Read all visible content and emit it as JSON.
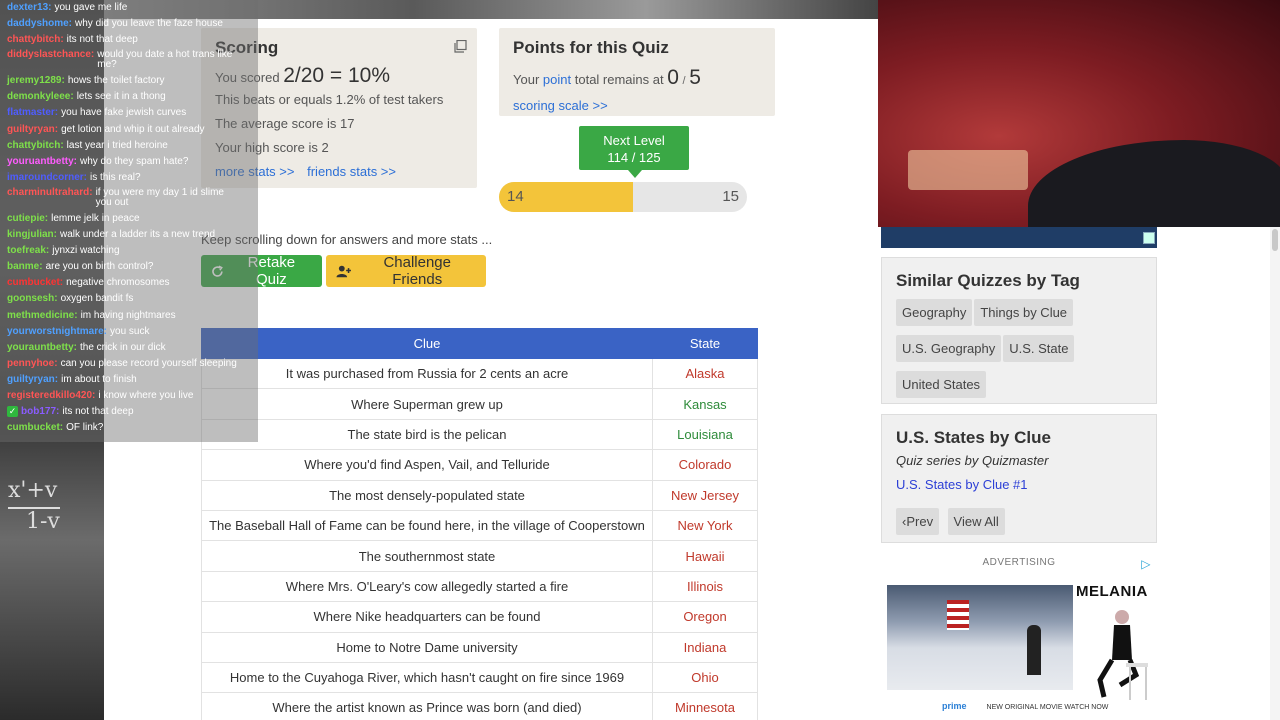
{
  "scoring": {
    "title": "Scoring",
    "scored_prefix": "You scored",
    "score_value": "2/20 = 10%",
    "beats": "This beats or equals 1.2% of test takers",
    "average": "The average score is 17",
    "high": "Your high score is 2",
    "more_stats": "more stats >>",
    "friends_stats": "friends stats >>"
  },
  "points": {
    "title": "Points for this Quiz",
    "prefix": "Your",
    "point_link": "point",
    "mid": "total remains at",
    "value": "0",
    "sep": "/",
    "max": "5",
    "scale_link": "scoring scale >>"
  },
  "level": {
    "label": "Next Level",
    "progress_text": "114 / 125",
    "current": "14",
    "next": "15",
    "progress_fraction": 0.54
  },
  "keep_scrolling": "Keep scrolling down for answers and more stats ...",
  "buttons": {
    "retake": "Retake Quiz",
    "challenge": "Challenge Friends"
  },
  "table": {
    "headers": [
      "Clue",
      "State"
    ],
    "rows": [
      {
        "clue": "It was purchased from Russia for 2 cents an acre",
        "state": "Alaska",
        "correct": false
      },
      {
        "clue": "Where Superman grew up",
        "state": "Kansas",
        "correct": true
      },
      {
        "clue": "The state bird is the pelican",
        "state": "Louisiana",
        "correct": true
      },
      {
        "clue": "Where you'd find Aspen, Vail, and Telluride",
        "state": "Colorado",
        "correct": false
      },
      {
        "clue": "The most densely-populated state",
        "state": "New Jersey",
        "correct": false
      },
      {
        "clue": "The Baseball Hall of Fame can be found here, in the village of Cooperstown",
        "state": "New York",
        "correct": false
      },
      {
        "clue": "The southernmost state",
        "state": "Hawaii",
        "correct": false
      },
      {
        "clue": "Where Mrs. O'Leary's cow allegedly started a fire",
        "state": "Illinois",
        "correct": false
      },
      {
        "clue": "Where Nike headquarters can be found",
        "state": "Oregon",
        "correct": false
      },
      {
        "clue": "Home to Notre Dame university",
        "state": "Indiana",
        "correct": false
      },
      {
        "clue": "Home to the Cuyahoga River, which hasn't caught on fire since 1969",
        "state": "Ohio",
        "correct": false
      },
      {
        "clue": "Where the artist known as Prince was born (and died)",
        "state": "Minnesota",
        "correct": false
      }
    ]
  },
  "similar": {
    "title": "Similar Quizzes by Tag",
    "tags": [
      "Geography",
      "Things by Clue",
      "U.S. Geography",
      "U.S. State",
      "United States"
    ]
  },
  "series": {
    "title": "U.S. States by Clue",
    "subtitle": "Quiz series by Quizmaster",
    "link": "U.S. States by Clue #1",
    "prev": "Prev",
    "view_all": "View All"
  },
  "ad": {
    "label": "ADVERTISING",
    "brand": "MELANIA",
    "prime": "prime",
    "prime_rest": "NEW ORIGINAL MOVIE WATCH NOW"
  },
  "chat": [
    {
      "user": "dexter13:",
      "text": "you gave me life",
      "color": "#4fa0ff"
    },
    {
      "user": "daddyshome:",
      "text": "why did you leave the faze house",
      "color": "#4fa0ff"
    },
    {
      "user": "chattybitch:",
      "text": "its not that deep",
      "color": "#ff5555"
    },
    {
      "user": "diddyslastchance:",
      "text": "would you date a hot trans like me?",
      "color": "#ff5555",
      "wrap": true
    },
    {
      "user": "jeremy1289:",
      "text": "hows the toilet factory",
      "color": "#7ee04a"
    },
    {
      "user": "demonkyleee:",
      "text": "lets see it in a thong",
      "color": "#7ee04a"
    },
    {
      "user": "flatmaster:",
      "text": "you have fake jewish curves",
      "color": "#4f5dff"
    },
    {
      "user": "guiltyryan:",
      "text": "get lotion and whip it out already",
      "color": "#ff5555"
    },
    {
      "user": "chattybitch:",
      "text": "last year i tried heroine",
      "color": "#7ee04a"
    },
    {
      "user": "youruantbetty:",
      "text": "why do they spam hate?",
      "color": "#ff5cff"
    },
    {
      "user": "imaroundcorner:",
      "text": "is this real?",
      "color": "#4f5dff"
    },
    {
      "user": "charminultrahard:",
      "text": "if you were my day 1 id slime you out",
      "color": "#ff5555",
      "wrap": true
    },
    {
      "user": "cutiepie:",
      "text": "lemme jelk in peace",
      "color": "#7ee04a"
    },
    {
      "user": "kingjulian:",
      "text": "walk under a ladder its a new trend",
      "color": "#7ee04a"
    },
    {
      "user": "toefreak:",
      "text": "jynxzi watching",
      "color": "#7ee04a"
    },
    {
      "user": "banme:",
      "text": "are you on birth control?",
      "color": "#7ee04a"
    },
    {
      "user": "cumbucket:",
      "text": "negative chromosomes",
      "color": "#ff3333"
    },
    {
      "user": "goonsesh:",
      "text": "oxygen bandit fs",
      "color": "#7ee04a"
    },
    {
      "user": "methmedicine:",
      "text": "im having nightmares",
      "color": "#7ee04a"
    },
    {
      "user": "yourworstnightmare:",
      "text": "you suck",
      "color": "#4fa0ff"
    },
    {
      "user": "yourauntbetty:",
      "text": "the crick in our dick",
      "color": "#7ee04a"
    },
    {
      "user": "pennyhoe:",
      "text": "can you please record yourself sleeping",
      "color": "#ff5555"
    },
    {
      "user": "guiltyryan:",
      "text": "im about to finish",
      "color": "#4fa0ff"
    },
    {
      "user": "registeredkillo420:",
      "text": "i know where you live",
      "color": "#ff5555"
    },
    {
      "user": "bob177:",
      "text": "its not that deep",
      "color": "#8a5cff",
      "check": true
    },
    {
      "user": "cumbucket:",
      "text": "OF link?",
      "color": "#7ee04a"
    }
  ],
  "colors": {
    "accent_blue": "#3a63c5",
    "green": "#3aa845",
    "yellow": "#f3c43a",
    "wrong_red": "#c0392b",
    "right_green": "#2e8b3a"
  }
}
